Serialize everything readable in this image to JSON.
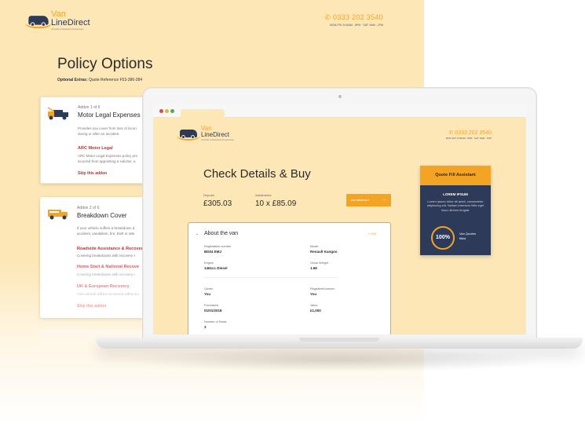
{
  "brand": {
    "logo_line1": "Van",
    "logo_line2": "LineDirect",
    "logo_tag": "a brand of Advanced Insurance",
    "phone": "0333 202 3540",
    "hours": "MON-FRI: 8:00AM - 8PM · SAT: 9AM - 1PM",
    "colors": {
      "accent": "#f4a423",
      "navy": "#2e3a59",
      "cream": "#fde7b7",
      "red": "#c2302e"
    }
  },
  "policy_page": {
    "title": "Policy Options",
    "subtitle_label": "Optional Extras:",
    "subtitle_value": "Quote Reference F53-386-284",
    "addons": [
      {
        "icon": "tow-truck-icon",
        "label": "Addon 1 of 6",
        "title": "Motor Legal Expenses",
        "description": "Provides you cover from loss of incon\nduring or after an accident.",
        "options": [
          {
            "title": "ARC Motor Legal",
            "description": "ARC Motor Legal Expenses policy pro\nincurred from appointing a solicitor, a"
          }
        ],
        "skip": "Skip this addon"
      },
      {
        "icon": "breakdown-truck-icon",
        "label": "Addon 2 of 6",
        "title": "Breakdown Cover",
        "description": "If your vehicle suffers a breakdown d\naccident, vandalism, fire, theft or atte",
        "options": [
          {
            "title": "Roadside Assistance & Recover",
            "description": "Covering breakdowns with recovery t"
          },
          {
            "title": "Home Start & National Recove",
            "description": "Covering breakdowns with recovery t"
          },
          {
            "title": "UK & European Recovery",
            "description": "Your vehicle will be recovered within Eu"
          }
        ],
        "skip": "Skip this addon"
      }
    ]
  },
  "checkout": {
    "title": "Check Details & Buy",
    "deposit_label": "Deposit",
    "deposit_value": "£305.03",
    "instalments_label": "Instalments",
    "instalments_value": "10 x £85.09",
    "pay_button": "PAY MONTHLY",
    "section": {
      "title": "About the van",
      "edit": "Edit",
      "fields": [
        {
          "label": "Registration number",
          "value": "BD04 EMJ"
        },
        {
          "label": "Model",
          "value": "Renault Kangoo"
        },
        {
          "label": "Engine",
          "value": "1461cc Diesel"
        },
        {
          "label": "Gross Weight",
          "value": "1.68"
        },
        {
          "label": "Owner",
          "value": "You"
        },
        {
          "label": "Registered keeper",
          "value": "You"
        },
        {
          "label": "Purchased",
          "value": "01/01/2018"
        },
        {
          "label": "Value",
          "value": "£1,000"
        },
        {
          "label": "Number of Seats",
          "value": "3"
        }
      ]
    }
  },
  "assistant": {
    "title": "Quote Fill Assistant",
    "lorem_heading": "LOREM IPSUM",
    "lorem_text": "Lorem ipsum dolor sit amet, consectetur adipiscing elit. Nullam interdum felis eget risus ultrices feugiat.",
    "percent": "100%",
    "filled_label": "Van Quotes\nfilled"
  }
}
